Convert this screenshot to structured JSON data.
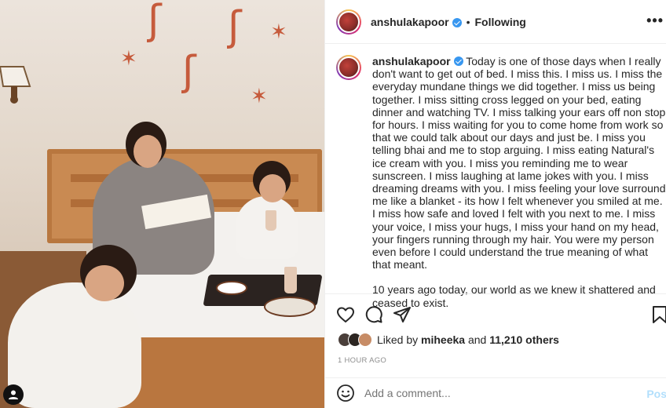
{
  "post": {
    "username": "anshulakapoor",
    "follow_status": "Following",
    "separator": "•",
    "more_icon": "more-horizontal-icon",
    "caption": {
      "username": "anshulakapoor",
      "paragraph1": "Today is one of those days when I really don't want to get out of bed. I miss this. I miss us. I miss the everyday mundane things we did together. I miss us being together. I miss sitting cross legged on your bed, eating dinner and watching TV. I miss talking your ears off non stop for hours. I miss waiting for you to come home from work so that we could talk about our days and just be. I miss you telling bhai and me to stop arguing. I miss eating Natural's ice cream with you. I miss you reminding me to wear sunscreen. I miss laughing at lame jokes with you. I miss dreaming dreams with you. I miss feeling your love surround me like a blanket - its how I felt whenever you smiled at me. I miss how safe and loved I felt with you next to me. I miss your voice, I miss your hugs, I miss your hand on my head, your fingers running through my hair. You were my person even before I could understand the true meaning of what that meant.",
      "paragraph2": "10 years ago today, our world as we knew it shattered and ceased to exist."
    },
    "likes": {
      "prefix": "Liked by",
      "user": "miheeka",
      "joiner": "and",
      "others": "11,210 others"
    },
    "timestamp": "1 HOUR AGO",
    "comment": {
      "placeholder": "Add a comment...",
      "post_label": "Pos"
    }
  },
  "colors": {
    "accent_link": "#b2dffc",
    "verified": "#3897f0",
    "muted": "#8e8e8e",
    "text": "#262626"
  }
}
